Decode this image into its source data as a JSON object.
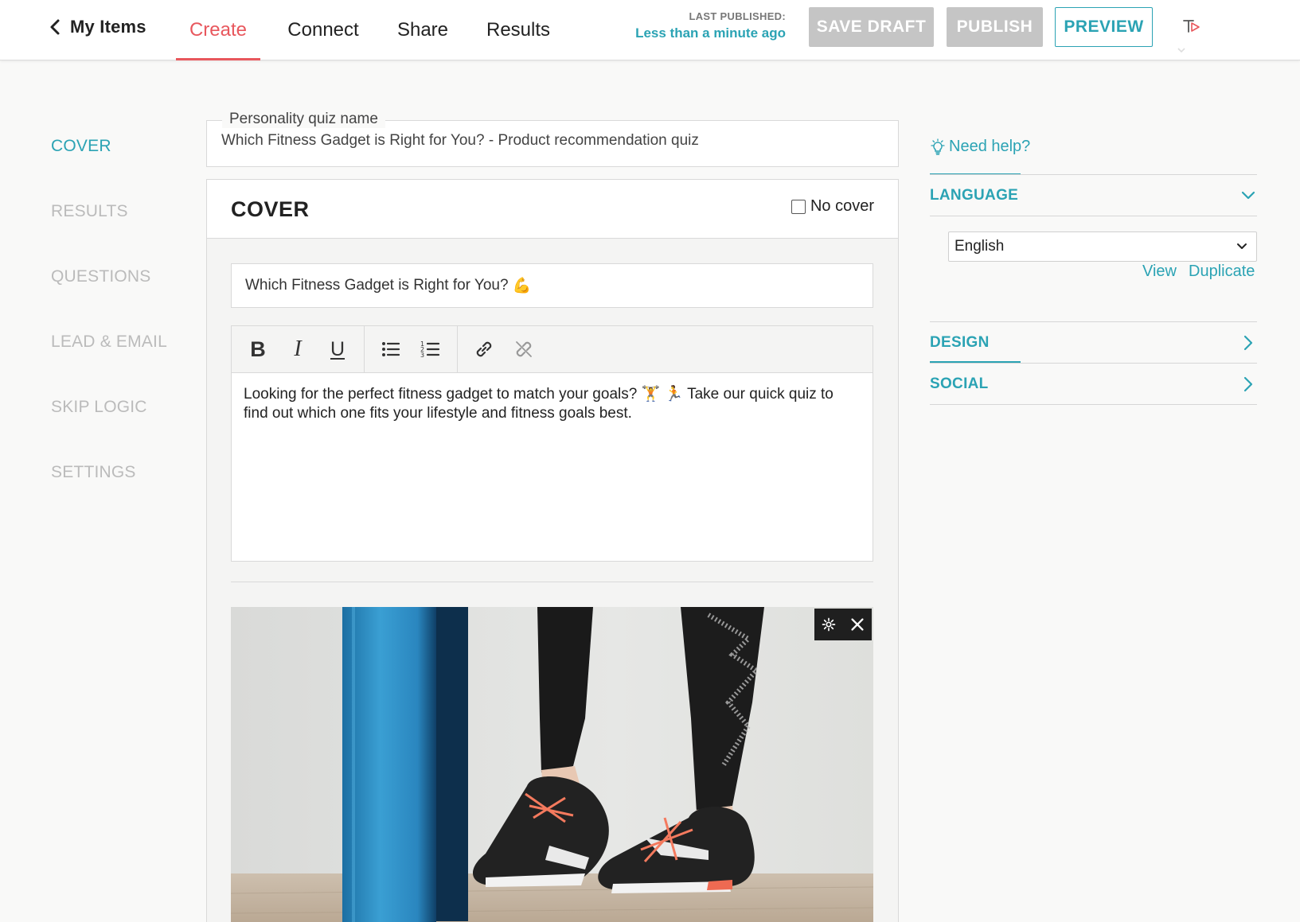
{
  "header": {
    "back_label": "My Items",
    "tabs": [
      {
        "label": "Create",
        "active": true
      },
      {
        "label": "Connect",
        "active": false
      },
      {
        "label": "Share",
        "active": false
      },
      {
        "label": "Results",
        "active": false
      }
    ],
    "last_published_label": "LAST PUBLISHED:",
    "last_published_value": "Less than a minute ago",
    "save_draft_label": "SAVE DRAFT",
    "publish_label": "PUBLISH",
    "preview_label": "PREVIEW"
  },
  "sidebar": {
    "items": [
      {
        "label": "COVER",
        "active": true
      },
      {
        "label": "RESULTS",
        "active": false
      },
      {
        "label": "QUESTIONS",
        "active": false
      },
      {
        "label": "LEAD & EMAIL",
        "active": false
      },
      {
        "label": "SKIP LOGIC",
        "active": false
      },
      {
        "label": "SETTINGS",
        "active": false
      }
    ]
  },
  "quiz": {
    "name_label": "Personality quiz name",
    "name_value": "Which Fitness Gadget is Right for You? - Product recommendation quiz"
  },
  "cover": {
    "section_title": "COVER",
    "no_cover_label": "No cover",
    "no_cover_checked": false,
    "title_value": "Which Fitness Gadget is Right for You?",
    "title_emoji": "💪",
    "description_part1": "Looking for the perfect fitness gadget to match your goals?",
    "description_emojis": "🏋️ 🏃",
    "description_part2": "Take our quick quiz to find out which one fits your lifestyle and fitness goals best.",
    "toolbar_icons": [
      "bold-icon",
      "italic-icon",
      "underline-icon",
      "bulleted-list-icon",
      "numbered-list-icon",
      "link-icon",
      "unlink-icon"
    ]
  },
  "right_panel": {
    "help_label": "Need help?",
    "language_label": "LANGUAGE",
    "language_selected": "English",
    "view_label": "View",
    "duplicate_label": "Duplicate",
    "design_label": "DESIGN",
    "social_label": "SOCIAL"
  },
  "colors": {
    "accent": "#2ba3b4",
    "active_tab": "#e8575d",
    "disabled_button": "#c5c5c5",
    "sidebar_inactive": "#bbbbbb",
    "page_background": "#f9f9f8"
  }
}
